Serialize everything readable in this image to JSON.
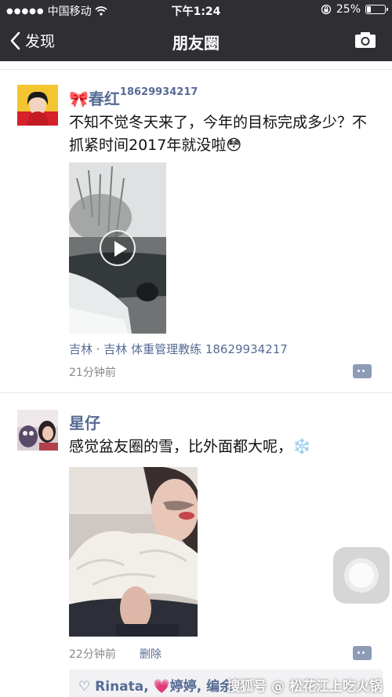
{
  "status_bar": {
    "signal": "●●●●●",
    "carrier": "中国移动",
    "time": "下午1:24",
    "battery_percent": 25,
    "battery_text": "25%"
  },
  "nav": {
    "back_label": "发现",
    "title": "朋友圈"
  },
  "posts": [
    {
      "name": "春红",
      "name_phone": "18629934217",
      "text": "不知不觉冬天来了，今年的目标完成多少？不抓紧时间2017年就没啦😳",
      "media": "video",
      "location": "吉林 · 吉林 体重管理教练 18629934217",
      "time": "21分钟前"
    },
    {
      "name": "星仔",
      "text": "感觉盆友圈的雪，比外面都大呢，❄️",
      "media": "photo",
      "time": "22分钟前",
      "delete_label": "删除"
    }
  ],
  "likes": {
    "text": "♡ Rinata, 💗婷婷, 编余"
  },
  "watermark": "搜狐号 @ 松花江上吃火锅",
  "icons": {
    "back": "chevron-left-icon",
    "camera": "camera-icon",
    "comment": "comment-more-icon",
    "wifi": "wifi-icon",
    "lock": "rotation-lock-icon",
    "battery": "battery-icon"
  },
  "colors": {
    "nav_bg": "#2e2e33",
    "name_link": "#576b95",
    "comment_btn": "#8e9cb8"
  }
}
